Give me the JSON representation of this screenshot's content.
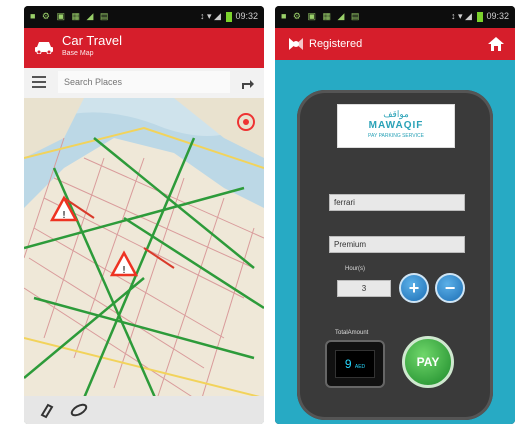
{
  "left_app": {
    "status_time": "09:32",
    "title": "Car Travel",
    "subtitle": "Base Map",
    "search": {
      "placeholder": "Search Places"
    },
    "icons": [
      "car-icon",
      "menu-icon",
      "directions-icon",
      "warning-icon",
      "layers-icon",
      "zoom-icon"
    ]
  },
  "right_app": {
    "status_time": "09:32",
    "title": "Registered",
    "sign": {
      "arabic": "مواقف",
      "name": "MAWAQIF",
      "tagline": "PAY PARKING SERVICE"
    },
    "fields": {
      "plate": "ferrari",
      "type": "Premium"
    },
    "hours_label": "Hour(s)",
    "hours_value": "3",
    "plus_label": "+",
    "minus_label": "−",
    "total_label": "TotalAmount",
    "total_value": "9",
    "currency": "AED",
    "pay_label": "PAY",
    "colors": {
      "appbar": "#d61e2b",
      "teal": "#27aac4",
      "pay": "#1c8a2a",
      "plus_minus": "#1e6fb5"
    }
  }
}
